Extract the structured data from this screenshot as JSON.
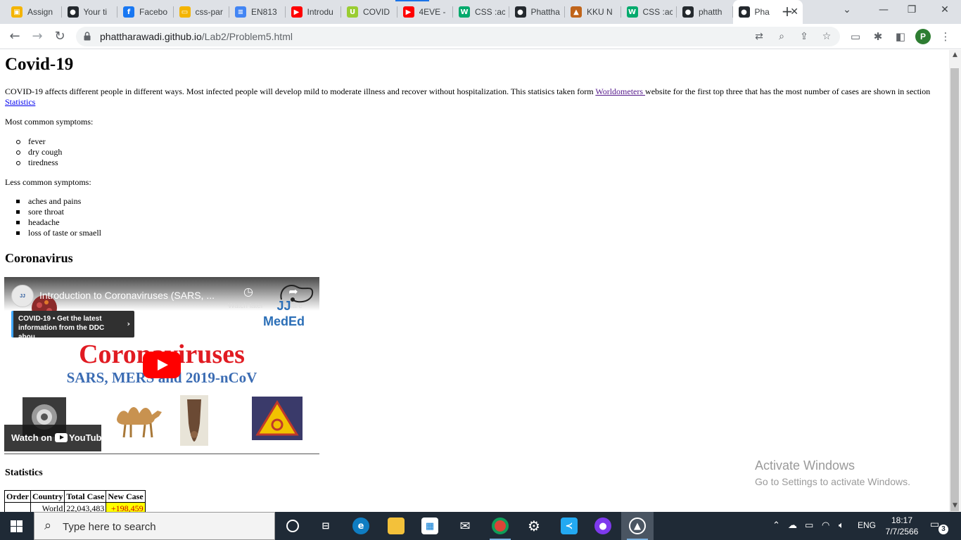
{
  "browser": {
    "tabs": [
      {
        "label": "Assign",
        "icon": "google-classroom-icon",
        "color": "#f4b400",
        "glyph": "▣"
      },
      {
        "label": "Your ti",
        "icon": "github-icon",
        "color": "#24292e",
        "glyph": "●"
      },
      {
        "label": "Facebo",
        "icon": "facebook-icon",
        "color": "#1877f2",
        "glyph": "f"
      },
      {
        "label": "css-par",
        "icon": "google-slides-icon",
        "color": "#f4b400",
        "glyph": "▭"
      },
      {
        "label": "EN813",
        "icon": "google-docs-icon",
        "color": "#4285f4",
        "glyph": "≡"
      },
      {
        "label": "Introdu",
        "icon": "youtube-icon",
        "color": "#ff0000",
        "glyph": "▶"
      },
      {
        "label": "COVID",
        "icon": "webflow-icon",
        "color": "#9acd32",
        "glyph": "U"
      },
      {
        "label": "4EVE -",
        "icon": "youtube-icon",
        "color": "#ff0000",
        "glyph": "▶"
      },
      {
        "label": "CSS :ac",
        "icon": "w3schools-icon",
        "color": "#04aa6d",
        "glyph": "W"
      },
      {
        "label": "Phattha",
        "icon": "github-icon",
        "color": "#24292e",
        "glyph": "●"
      },
      {
        "label": "KKU N",
        "icon": "kku-logo-icon",
        "color": "#c0641a",
        "glyph": "▲"
      },
      {
        "label": "CSS :ac",
        "icon": "w3schools-icon",
        "color": "#04aa6d",
        "glyph": "W"
      },
      {
        "label": "phatth",
        "icon": "github-icon",
        "color": "#24292e",
        "glyph": "●"
      },
      {
        "label": "Pha",
        "icon": "github-icon",
        "color": "#24292e",
        "glyph": "●",
        "active": true
      }
    ],
    "new_tab_glyph": "+",
    "window_controls": [
      "⌄",
      "—",
      "❐",
      "✕"
    ],
    "url_host": "phattharawadi.github.io",
    "url_path": "/Lab2/Problem5.html",
    "profile_initial": "P",
    "profile_color": "#2e7d32"
  },
  "page": {
    "title": "Covid-19",
    "intro_before_link1": "COVID-19 affects different people in different ways. Most infected people will develop mild to moderate illness and recover without hospitalization. This statisics taken form ",
    "link_worldometers": "Worldometers ",
    "intro_between": "website for the first top three that has the most number of cases are shown in section ",
    "link_statistics": "Statistics",
    "common_heading": "Most common symptoms:",
    "common_symptoms": [
      "fever",
      "dry cough",
      "tiredness"
    ],
    "less_heading": "Less common symptoms:",
    "less_symptoms": [
      "aches and pains",
      "sore throat",
      "headache",
      "loss of taste or smaell"
    ],
    "coronavirus_heading": "Coronavirus",
    "video": {
      "channel_avatar": "JJ MedEd",
      "title": "Introduction to Coronaviruses (SARS, ...",
      "watch_later": "Watch later",
      "share": "Share",
      "brand_line1": "JJ",
      "brand_line2": "MedEd",
      "card_text": "COVID-19 • Get the latest information from the DDC abou...",
      "big_title": "Coronaviruses",
      "sub_title": "SARS, MERS and 2019-nCoV",
      "watch_on": "Watch on",
      "youtube": "YouTube"
    },
    "statistics_heading": "Statistics",
    "table": {
      "headers": [
        "Order",
        "Country",
        "Total Case",
        "New Case"
      ],
      "rows": [
        {
          "order": "",
          "country": "World",
          "total": "22,043,483",
          "new": "+198,459"
        }
      ]
    }
  },
  "watermark": {
    "line1": "Activate Windows",
    "line2": "Go to Settings to activate Windows."
  },
  "taskbar": {
    "search_placeholder": "Type here to search",
    "language": "ENG",
    "time": "18:17",
    "date": "7/7/2566",
    "notification_count": "3"
  }
}
